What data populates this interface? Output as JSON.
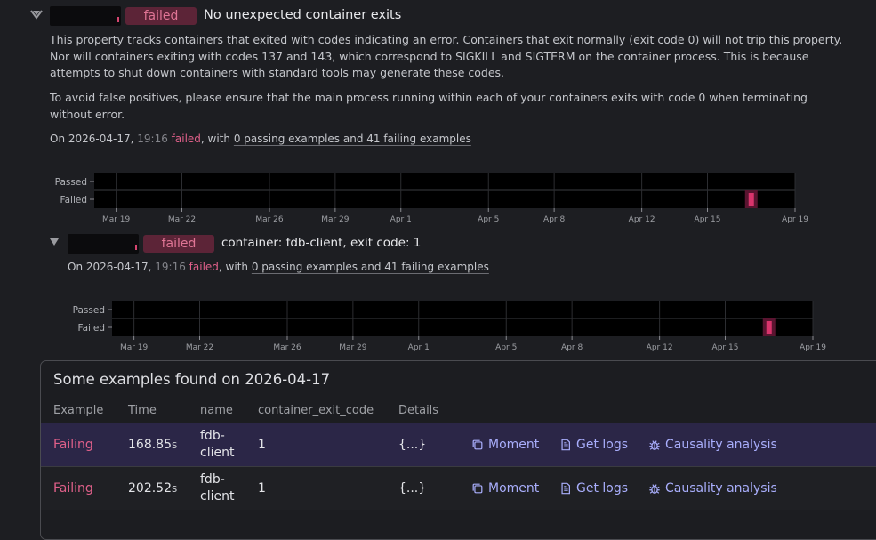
{
  "property": {
    "status": "failed",
    "title": "No unexpected container exits",
    "description_1": "This property tracks containers that exited with codes indicating an error. Containers that exit normally (exit code 0) will not trip this property. Nor will containers exiting with codes 137 and 143, which correspond to SIGKILL and SIGTERM on the container process. This is because attempts to shut down containers with standard tools may generate these codes.",
    "description_2": "To avoid false positives, please ensure that the main process running within each of your containers exits with code 0 when terminating without error.",
    "meta": {
      "prefix": "On 2026-04-17,",
      "time": "19:16",
      "status": "failed",
      "mid": ", with",
      "link": "0 passing examples and 41 failing examples"
    }
  },
  "sub_property": {
    "status": "failed",
    "title": "container: fdb-client, exit code: 1",
    "meta": {
      "prefix": "On 2026-04-17,",
      "time": "19:16",
      "status": "failed",
      "mid": ", with",
      "link": "0 passing examples and 41 failing examples"
    }
  },
  "chart_data": [
    {
      "type": "scatter",
      "y_categories": [
        "Passed",
        "Failed"
      ],
      "x_ticks": [
        "Mar 19",
        "Mar 22",
        "Mar 26",
        "Mar 29",
        "Apr 1",
        "Apr 5",
        "Apr 8",
        "Apr 12",
        "Apr 15",
        "Apr 19"
      ],
      "x_range": [
        "2026-03-18",
        "2026-04-19"
      ],
      "points": [
        {
          "x": "2026-04-17",
          "y": "Failed"
        }
      ],
      "colors": {
        "failed": "#d9346c",
        "background": "#000000"
      }
    },
    {
      "type": "scatter",
      "y_categories": [
        "Passed",
        "Failed"
      ],
      "x_ticks": [
        "Mar 19",
        "Mar 22",
        "Mar 26",
        "Mar 29",
        "Apr 1",
        "Apr 5",
        "Apr 8",
        "Apr 12",
        "Apr 15",
        "Apr 19"
      ],
      "x_range": [
        "2026-03-18",
        "2026-04-19"
      ],
      "points": [
        {
          "x": "2026-04-17",
          "y": "Failed"
        }
      ],
      "colors": {
        "failed": "#d9346c",
        "background": "#000000"
      }
    }
  ],
  "examples": {
    "title": "Some examples found on 2026-04-17",
    "columns": [
      "Example",
      "Time",
      "name",
      "container_exit_code",
      "Details"
    ],
    "rows": [
      {
        "example": "Failing",
        "time": "168.85",
        "unit": "s",
        "name_1": "fdb-",
        "name_2": "client",
        "exit_code": "1",
        "details": "{...}"
      },
      {
        "example": "Failing",
        "time": "202.52",
        "unit": "s",
        "name_1": "fdb-",
        "name_2": "client",
        "exit_code": "1",
        "details": "{...}"
      }
    ],
    "actions": {
      "moment": "Moment",
      "logs": "Get logs",
      "causality": "Causality analysis"
    }
  }
}
